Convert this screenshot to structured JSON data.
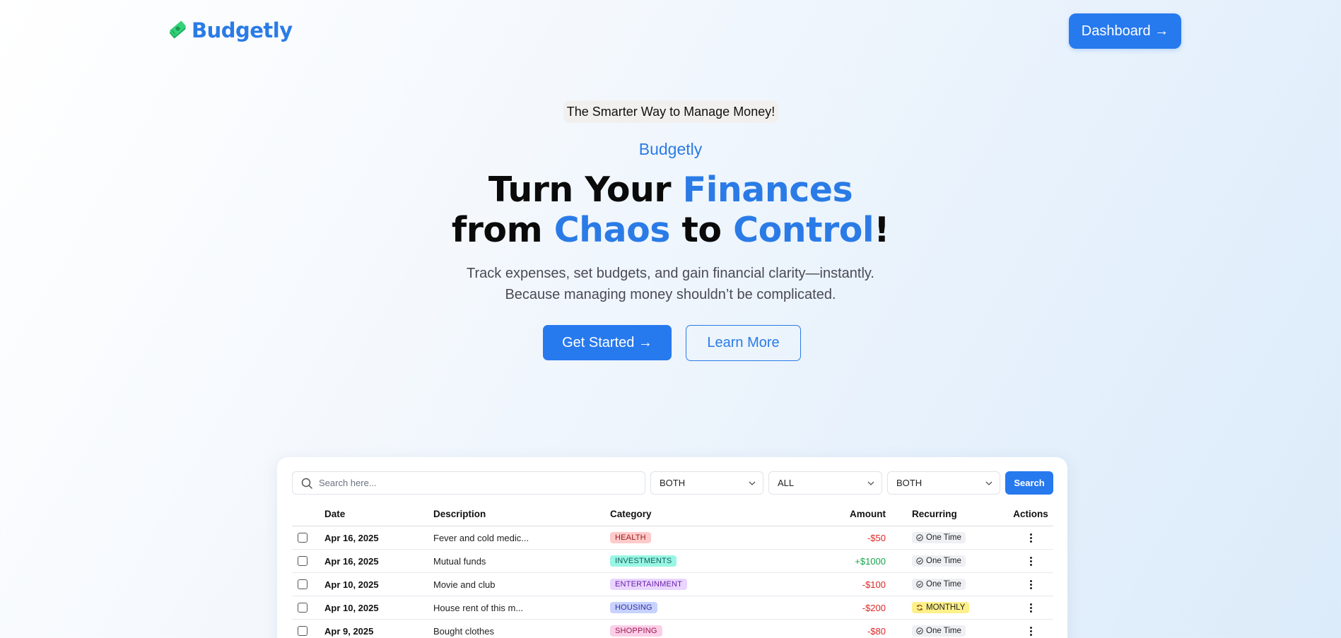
{
  "nav": {
    "logo_text": "Budgetly",
    "logo_icon": "money-icon",
    "dashboard_label": "Dashboard →"
  },
  "hero": {
    "pill": "The Smarter Way to Manage Money!",
    "brand": "Budgetly",
    "headline": {
      "line1_a": "Turn Your ",
      "line1_b": "Finances",
      "line2_a": "from ",
      "line2_b": "Chaos",
      "line2_c": " to ",
      "line2_d": "Control",
      "line2_e": "!"
    },
    "sub_line1": "Track expenses, set budgets, and gain financial clarity—instantly.",
    "sub_line2": "Because managing money shouldn’t be complicated.",
    "get_started": "Get Started →",
    "learn_more": "Learn More"
  },
  "filters": {
    "search_placeholder": "Search here...",
    "select1": "BOTH",
    "select2": "ALL",
    "select3": "BOTH",
    "search_button": "Search"
  },
  "table": {
    "headers": {
      "date": "Date",
      "description": "Description",
      "category": "Category",
      "amount": "Amount",
      "recurring": "Recurring",
      "actions": "Actions"
    },
    "rows": [
      {
        "date": "Apr 16, 2025",
        "description": "Fever and cold medic...",
        "category": "HEALTH",
        "amount": "-$50",
        "recurring": "One Time"
      },
      {
        "date": "Apr 16, 2025",
        "description": "Mutual funds",
        "category": "INVESTMENTS",
        "amount": "+$1000",
        "recurring": "One Time"
      },
      {
        "date": "Apr 10, 2025",
        "description": "Movie and club",
        "category": "ENTERTAINMENT",
        "amount": "-$100",
        "recurring": "One Time"
      },
      {
        "date": "Apr 10, 2025",
        "description": "House rent of this m...",
        "category": "HOUSING",
        "amount": "-$200",
        "recurring": "MONTHLY"
      },
      {
        "date": "Apr 9, 2025",
        "description": "Bought clothes",
        "category": "SHOPPING",
        "amount": "-$80",
        "recurring": "One Time"
      }
    ]
  },
  "colors": {
    "accent": "#2779ee",
    "brand_text": "#2a7be6",
    "negative": "#dc2626",
    "positive": "#16a34a",
    "health_bg": "#fecaca",
    "health_fg": "#991b1b",
    "investments_bg": "#99f6e4",
    "investments_fg": "#115e59",
    "entertainment_bg": "#e9d5ff",
    "entertainment_fg": "#6b21a8",
    "housing_bg": "#c7d2fe",
    "housing_fg": "#3730a3",
    "shopping_bg": "#fbcfe8",
    "shopping_fg": "#9d174d",
    "onetime_bg": "#eef0f3",
    "monthly_bg": "#fef08a"
  }
}
